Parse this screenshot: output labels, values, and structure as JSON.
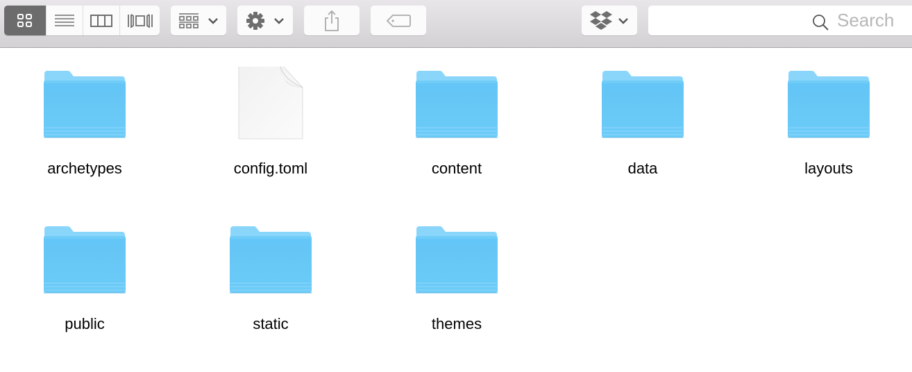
{
  "toolbar": {
    "view_modes": [
      {
        "name": "icon-view",
        "icon": "grid-icon",
        "active": true
      },
      {
        "name": "list-view",
        "icon": "list-icon",
        "active": false
      },
      {
        "name": "column-view",
        "icon": "columns-icon",
        "active": false
      },
      {
        "name": "cover-flow-view",
        "icon": "cover-flow-icon",
        "active": false
      }
    ],
    "arrange_button": {
      "icon": "arrange-grid-icon",
      "has_dropdown": true
    },
    "action_button": {
      "icon": "gear-icon",
      "has_dropdown": true
    },
    "share_button": {
      "icon": "share-icon"
    },
    "tag_button": {
      "icon": "tag-icon"
    },
    "dropbox_button": {
      "icon": "dropbox-icon",
      "has_dropdown": true
    },
    "search": {
      "placeholder": "Search",
      "value": ""
    }
  },
  "items": [
    {
      "name": "archetypes",
      "kind": "folder"
    },
    {
      "name": "config.toml",
      "kind": "file"
    },
    {
      "name": "content",
      "kind": "folder"
    },
    {
      "name": "data",
      "kind": "folder"
    },
    {
      "name": "layouts",
      "kind": "folder"
    },
    {
      "name": "public",
      "kind": "folder"
    },
    {
      "name": "static",
      "kind": "folder"
    },
    {
      "name": "themes",
      "kind": "folder"
    }
  ],
  "colors": {
    "folder_front": "#6ccbf7",
    "folder_tab": "#8ad6fb",
    "toolbar_active": "#6c6c6c",
    "icon_gray": "#6e6e6e"
  }
}
